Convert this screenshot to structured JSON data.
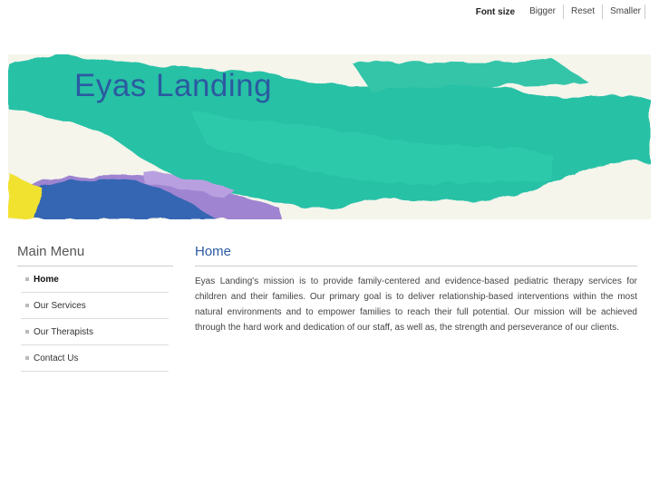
{
  "fontbar": {
    "label": "Font size",
    "bigger": "Bigger",
    "reset": "Reset",
    "smaller": "Smaller"
  },
  "header": {
    "site_title": "Eyas Landing"
  },
  "sidebar": {
    "title": "Main Menu",
    "items": [
      {
        "label": "Home",
        "active": true
      },
      {
        "label": "Our Services",
        "active": false
      },
      {
        "label": "Our Therapists",
        "active": false
      },
      {
        "label": "Contact Us",
        "active": false
      }
    ]
  },
  "main": {
    "heading": "Home",
    "body": "Eyas Landing's mission is to provide family-centered and evidence-based pediatric therapy services for children and their families. Our primary goal is to deliver relationship-based interventions within the most natural environments and to empower families to reach their full potential. Our mission will be achieved through the hard work and dedication of our staff, as well as, the strength and perseverance of our clients."
  },
  "colors": {
    "accent": "#2b5aa0",
    "paint_teal": "#1fbfa3",
    "paint_blue": "#2a5fb0",
    "paint_purple": "#9a7fd0",
    "paint_yellow": "#f2e227"
  }
}
